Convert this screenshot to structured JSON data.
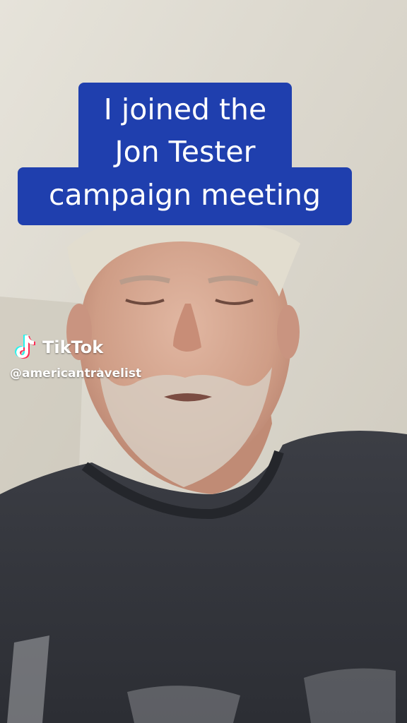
{
  "caption": {
    "line1": "I joined the",
    "line2": "Jon Tester",
    "line3": "campaign meeting",
    "background_color": "#1f3fae",
    "text_color": "#ffffff"
  },
  "watermark": {
    "logo_icon": "tiktok-logo-icon",
    "brand": "TikTok",
    "handle": "@americantravelist"
  }
}
